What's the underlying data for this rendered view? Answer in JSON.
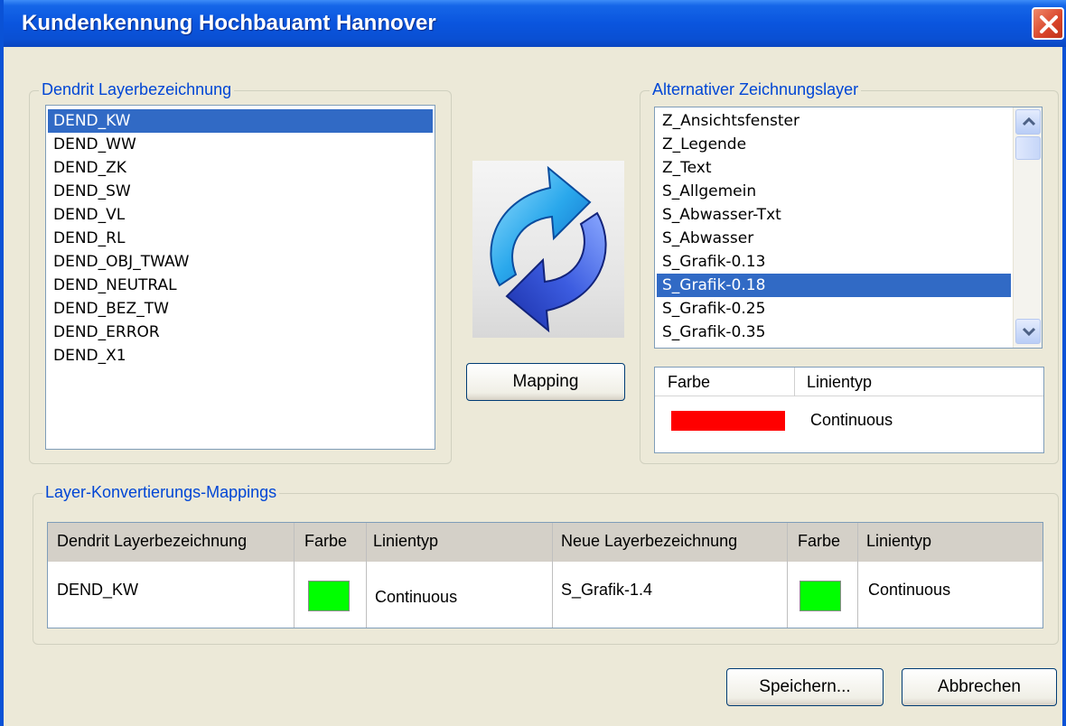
{
  "window": {
    "title": "Kundenkennung Hochbauamt Hannover"
  },
  "left_group": {
    "label": "Dendrit Layerbezeichnung",
    "items": [
      "DEND_KW",
      "DEND_WW",
      "DEND_ZK",
      "DEND_SW",
      "DEND_VL",
      "DEND_RL",
      "DEND_OBJ_TWAW",
      "DEND_NEUTRAL",
      "DEND_BEZ_TW",
      "DEND_ERROR",
      "DEND_X1"
    ],
    "selected_index": 0
  },
  "mapping_button": {
    "label": "Mapping"
  },
  "right_group": {
    "label": "Alternativer Zeichnungslayer",
    "items": [
      "Z_Ansichtsfenster",
      "Z_Legende",
      "Z_Text",
      "S_Allgemein",
      "S_Abwasser-Txt",
      "S_Abwasser",
      "S_Grafik-0.13",
      "S_Grafik-0.18",
      "S_Grafik-0.25",
      "S_Grafik-0.35"
    ],
    "selected_index": 7,
    "props": {
      "col_color": "Farbe",
      "col_linetype": "Linientyp",
      "color": "#ff0000",
      "linetype": "Continuous"
    }
  },
  "mappings_group": {
    "label": "Layer-Konvertierungs-Mappings",
    "headers": [
      "Dendrit Layerbezeichnung",
      "Farbe",
      "Linientyp",
      "Neue Layerbezeichnung",
      "Farbe",
      "Linientyp"
    ],
    "rows": [
      {
        "source_layer": "DEND_KW",
        "source_color": "#00ff00",
        "source_linetype": "Continuous",
        "target_layer": "S_Grafik-1.4",
        "target_color": "#00ff00",
        "target_linetype": "Continuous"
      }
    ]
  },
  "footer": {
    "save_label": "Speichern...",
    "cancel_label": "Abbrechen"
  },
  "icons": {
    "refresh": "refresh-arrows-icon",
    "close": "close-icon",
    "scroll_up": "chevron-up-icon",
    "scroll_down": "chevron-down-icon"
  }
}
